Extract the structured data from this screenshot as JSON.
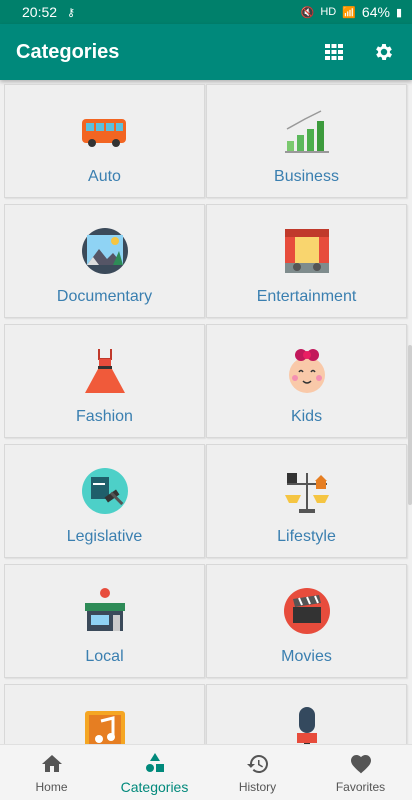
{
  "status_bar": {
    "time": "20:52",
    "network": "HD",
    "battery": "64%"
  },
  "app_bar": {
    "title": "Categories",
    "grid_icon": "grid-view-icon",
    "settings_icon": "gear-icon"
  },
  "categories": [
    {
      "label": "Auto",
      "icon": "bus-icon"
    },
    {
      "label": "Business",
      "icon": "bar-chart-growth-icon"
    },
    {
      "label": "Documentary",
      "icon": "landscape-picture-icon"
    },
    {
      "label": "Entertainment",
      "icon": "theater-stage-icon"
    },
    {
      "label": "Fashion",
      "icon": "dress-icon"
    },
    {
      "label": "Kids",
      "icon": "baby-face-icon"
    },
    {
      "label": "Legislative",
      "icon": "gavel-book-icon"
    },
    {
      "label": "Lifestyle",
      "icon": "balance-scale-icon"
    },
    {
      "label": "Local",
      "icon": "store-location-icon"
    },
    {
      "label": "Movies",
      "icon": "clapperboard-icon"
    },
    {
      "label": "",
      "icon": "music-note-icon"
    },
    {
      "label": "",
      "icon": "news-microphone-icon"
    }
  ],
  "bottom_nav": [
    {
      "label": "Home",
      "icon": "home-icon"
    },
    {
      "label": "Categories",
      "icon": "shapes-icon"
    },
    {
      "label": "History",
      "icon": "history-icon"
    },
    {
      "label": "Favorites",
      "icon": "heart-icon"
    }
  ],
  "colors": {
    "primary": "#00897b",
    "status": "#00806b",
    "label": "#3a7fb0"
  }
}
